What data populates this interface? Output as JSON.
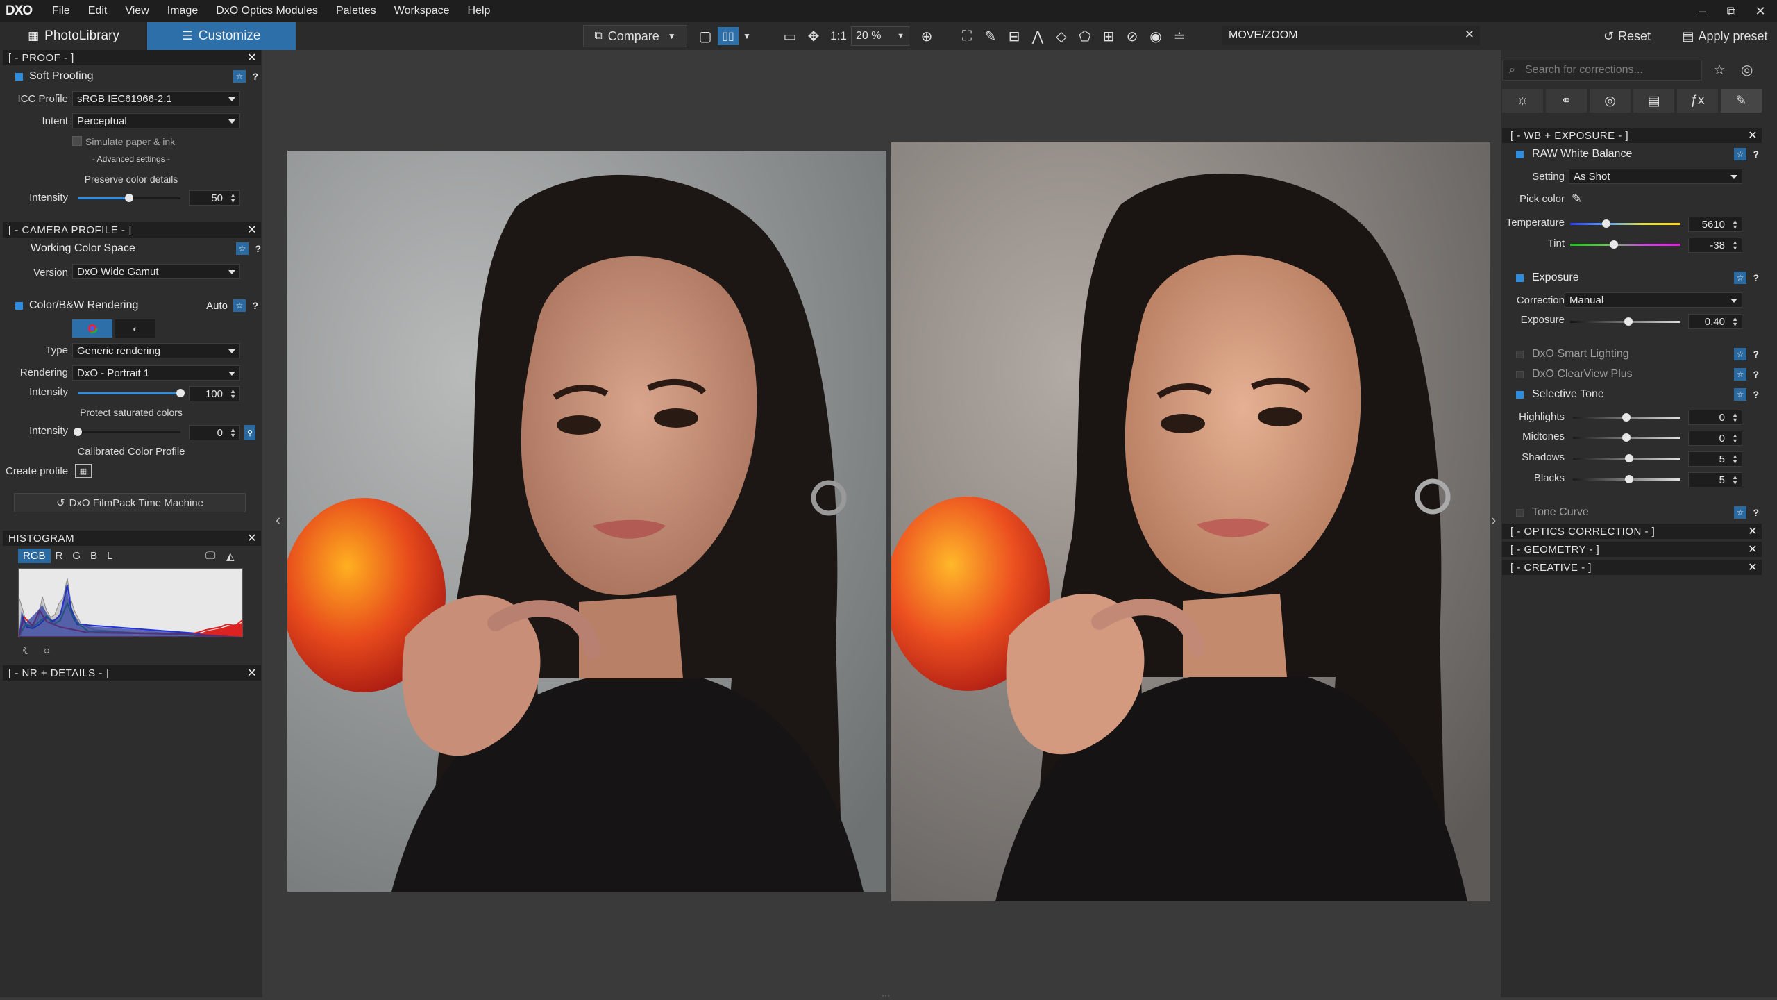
{
  "menubar": {
    "logo": "DXO",
    "items": [
      "File",
      "Edit",
      "View",
      "Image",
      "DxO Optics Modules",
      "Palettes",
      "Workspace",
      "Help"
    ],
    "window_controls": [
      "–",
      "⧉",
      "✕"
    ]
  },
  "toolbar": {
    "tab_library": "PhotoLibrary",
    "tab_customize": "Customize",
    "compare_label": "Compare",
    "one_to_one": "1:1",
    "zoom_value": "20 %",
    "tool_name": "MOVE/ZOOM",
    "reset_label": "Reset",
    "apply_preset_label": "Apply preset"
  },
  "left": {
    "proof": {
      "header": "[  -  PROOF  -  ]",
      "tool": "Soft Proofing",
      "icc_label": "ICC Profile",
      "icc_value": "sRGB IEC61966-2.1",
      "intent_label": "Intent",
      "intent_value": "Perceptual",
      "simulate_label": "Simulate paper & ink",
      "advanced": "- Advanced settings -",
      "preserve": "Preserve color details",
      "intensity_label": "Intensity",
      "intensity_value": "50",
      "intensity_fraction": 0.5
    },
    "camera": {
      "header": "[  -  CAMERA PROFILE  -  ]",
      "wcs_tool": "Working Color Space",
      "version_label": "Version",
      "version_value": "DxO Wide Gamut",
      "cbw_tool": "Color/B&W Rendering",
      "auto_label": "Auto",
      "type_label": "Type",
      "type_value": "Generic rendering",
      "rendering_label": "Rendering",
      "rendering_value": "DxO - Portrait 1",
      "intensity_label": "Intensity",
      "intensity_value": "100",
      "intensity_fraction": 1.0,
      "protect_label": "Protect saturated colors",
      "protect_intensity_label": "Intensity",
      "protect_intensity_value": "0",
      "protect_fraction": 0.0,
      "calibrated_label": "Calibrated Color Profile",
      "create_profile_label": "Create profile",
      "filmpack_label": "DxO FilmPack Time Machine"
    },
    "histogram": {
      "header": "HISTOGRAM",
      "tabs": [
        "RGB",
        "R",
        "G",
        "B",
        "L"
      ]
    },
    "nr_header": "[  -  NR + DETAILS  -  ]"
  },
  "right": {
    "search_placeholder": "Search for corrections...",
    "wb_header": "[  -  WB + EXPOSURE  -  ]",
    "raw_wb": {
      "tool": "RAW White Balance",
      "setting_label": "Setting",
      "setting_value": "As Shot",
      "pick_label": "Pick color",
      "temp_label": "Temperature",
      "temp_value": "5610",
      "temp_fraction": 0.33,
      "tint_label": "Tint",
      "tint_value": "-38",
      "tint_fraction": 0.4
    },
    "exposure": {
      "tool": "Exposure",
      "correction_label": "Correction",
      "correction_value": "Manual",
      "exposure_label": "Exposure",
      "exposure_value": "0.40",
      "exposure_fraction": 0.53
    },
    "smart_lighting": "DxO Smart Lighting",
    "clearview": "DxO ClearView Plus",
    "selective_tone": {
      "tool": "Selective Tone",
      "rows": [
        {
          "label": "Highlights",
          "value": "0",
          "fraction": 0.5
        },
        {
          "label": "Midtones",
          "value": "0",
          "fraction": 0.5
        },
        {
          "label": "Shadows",
          "value": "5",
          "fraction": 0.525
        },
        {
          "label": "Blacks",
          "value": "5",
          "fraction": 0.525
        }
      ]
    },
    "tone_curve": "Tone Curve",
    "optics_header": "[  -  OPTICS CORRECTION  -  ]",
    "geometry_header": "[  -  GEOMETRY  -  ]",
    "creative_header": "[  -  CREATIVE  -  ]"
  },
  "colors": {
    "accent": "#2d6fa8",
    "checkbox_on": "#2f8de0",
    "panel_bg": "#2d2d2d",
    "canvas_bg": "#3a3a3a"
  }
}
